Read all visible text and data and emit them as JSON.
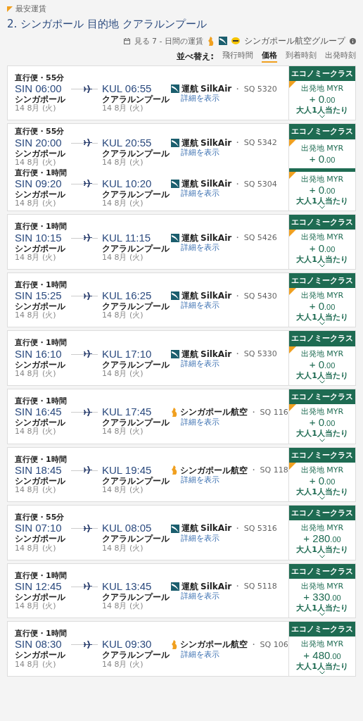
{
  "header": {
    "badge": "最安運賃",
    "title": "2. シンガポール 目的地 クアラルンプール",
    "week_link": "見る 7 - 日間の運賃",
    "group_label": "シンガポール航空グループ"
  },
  "sort": {
    "label": "並べ替え:",
    "options": [
      {
        "label": "飛行時間",
        "selected": false
      },
      {
        "label": "価格",
        "selected": true
      },
      {
        "label": "到着時刻",
        "selected": false
      },
      {
        "label": "出発時刻",
        "selected": false
      }
    ]
  },
  "cards": [
    {
      "rows": [
        {
          "duration": "直行便・55分",
          "dep_time": "SIN 06:00",
          "dep_city": "シンガポール",
          "dep_date": "14 8月 (火)",
          "arr_time": "KUL 06:55",
          "arr_city": "クアラルンプール",
          "arr_date": "14 8月 (火)",
          "kind": "regional",
          "operated": "運航",
          "airline": "SilkAir",
          "flight": "・ SQ 5320",
          "details": "詳細を表示"
        }
      ],
      "fares": [
        {
          "class_label": "エコノミークラス",
          "cheapest": true,
          "origin": "出発地 MYR",
          "sign": "+",
          "amount": "0",
          "decimals": ".00",
          "per_adult": "大人1人当たり",
          "expandable": true
        }
      ]
    },
    {
      "rows": [
        {
          "duration": "直行便・55分",
          "dep_time": "SIN 20:00",
          "dep_city": "シンガポール",
          "dep_date": "14 8月 (火)",
          "arr_time": "KUL 20:55",
          "arr_city": "クアラルンプール",
          "arr_date": "14 8月 (火)",
          "kind": "regional",
          "operated": "運航",
          "airline": "SilkAir",
          "flight": "・ SQ 5342",
          "details": "詳細を表示"
        },
        {
          "duration": "直行便・1時間",
          "dep_time": "SIN 09:20",
          "dep_city": "シンガポール",
          "dep_date": "14 8月 (火)",
          "arr_time": "KUL 10:20",
          "arr_city": "クアラルンプール",
          "arr_date": "14 8月 (火)",
          "kind": "regional",
          "operated": "運航",
          "airline": "SilkAir",
          "flight": "・ SQ 5304",
          "details": "詳細を表示"
        }
      ],
      "fares": [
        {
          "class_label": "エコノミークラス",
          "cheapest": true,
          "origin": "出発地 MYR",
          "sign": "+",
          "amount": "0",
          "decimals": ".00",
          "expandable": false
        },
        {
          "cheapest": true,
          "origin": "出発地 MYR",
          "sign": "+",
          "amount": "0",
          "decimals": ".00",
          "per_adult": "大人1人当たり",
          "expandable": true
        }
      ]
    },
    {
      "rows": [
        {
          "duration": "直行便・1時間",
          "dep_time": "SIN 10:15",
          "dep_city": "シンガポール",
          "dep_date": "14 8月 (火)",
          "arr_time": "KUL 11:15",
          "arr_city": "クアラルンプール",
          "arr_date": "14 8月 (火)",
          "kind": "regional",
          "operated": "運航",
          "airline": "SilkAir",
          "flight": "・ SQ 5426",
          "details": "詳細を表示"
        }
      ],
      "fares": [
        {
          "class_label": "エコノミークラス",
          "cheapest": true,
          "origin": "出発地 MYR",
          "sign": "+",
          "amount": "0",
          "decimals": ".00",
          "per_adult": "大人1人当たり",
          "expandable": true
        }
      ]
    },
    {
      "rows": [
        {
          "duration": "直行便・1時間",
          "dep_time": "SIN 15:25",
          "dep_city": "シンガポール",
          "dep_date": "14 8月 (火)",
          "arr_time": "KUL 16:25",
          "arr_city": "クアラルンプール",
          "arr_date": "14 8月 (火)",
          "kind": "regional",
          "operated": "運航",
          "airline": "SilkAir",
          "flight": "・ SQ 5430",
          "details": "詳細を表示"
        }
      ],
      "fares": [
        {
          "class_label": "エコノミークラス",
          "cheapest": true,
          "origin": "出発地 MYR",
          "sign": "+",
          "amount": "0",
          "decimals": ".00",
          "per_adult": "大人1人当たり",
          "expandable": true
        }
      ]
    },
    {
      "rows": [
        {
          "duration": "直行便・1時間",
          "dep_time": "SIN 16:10",
          "dep_city": "シンガポール",
          "dep_date": "14 8月 (火)",
          "arr_time": "KUL 17:10",
          "arr_city": "クアラルンプール",
          "arr_date": "14 8月 (火)",
          "kind": "regional",
          "operated": "運航",
          "airline": "SilkAir",
          "flight": "・ SQ 5330",
          "details": "詳細を表示"
        }
      ],
      "fares": [
        {
          "class_label": "エコノミークラス",
          "cheapest": true,
          "origin": "出発地 MYR",
          "sign": "+",
          "amount": "0",
          "decimals": ".00",
          "per_adult": "大人1人当たり",
          "expandable": true
        }
      ]
    },
    {
      "rows": [
        {
          "duration": "直行便・1時間",
          "dep_time": "SIN 16:45",
          "dep_city": "シンガポール",
          "dep_date": "14 8月 (火)",
          "arr_time": "KUL 17:45",
          "arr_city": "クアラルンプール",
          "arr_date": "14 8月 (火)",
          "kind": "mainline",
          "airline": "シンガポール航空",
          "flight": "・ SQ 116",
          "details": "詳細を表示"
        }
      ],
      "fares": [
        {
          "class_label": "エコノミークラス",
          "cheapest": true,
          "origin": "出発地 MYR",
          "sign": "+",
          "amount": "0",
          "decimals": ".00",
          "per_adult": "大人1人当たり",
          "expandable": true
        }
      ]
    },
    {
      "rows": [
        {
          "duration": "直行便・1時間",
          "dep_time": "SIN 18:45",
          "dep_city": "シンガポール",
          "dep_date": "14 8月 (火)",
          "arr_time": "KUL 19:45",
          "arr_city": "クアラルンプール",
          "arr_date": "14 8月 (火)",
          "kind": "mainline",
          "airline": "シンガポール航空",
          "flight": "・ SQ 118",
          "details": "詳細を表示"
        }
      ],
      "fares": [
        {
          "class_label": "エコノミークラス",
          "cheapest": true,
          "origin": "出発地 MYR",
          "sign": "+",
          "amount": "0",
          "decimals": ".00",
          "per_adult": "大人1人当たり",
          "expandable": true
        }
      ]
    },
    {
      "rows": [
        {
          "duration": "直行便・55分",
          "dep_time": "SIN 07:10",
          "dep_city": "シンガポール",
          "dep_date": "14 8月 (火)",
          "arr_time": "KUL 08:05",
          "arr_city": "クアラルンプール",
          "arr_date": "14 8月 (火)",
          "kind": "regional",
          "operated": "運航",
          "airline": "SilkAir",
          "flight": "・ SQ 5316",
          "details": "詳細を表示"
        }
      ],
      "fares": [
        {
          "class_label": "エコノミークラス",
          "cheapest": false,
          "origin": "出発地 MYR",
          "sign": "+",
          "amount": "280",
          "decimals": ".00",
          "per_adult": "大人1人当たり",
          "expandable": true
        }
      ]
    },
    {
      "rows": [
        {
          "duration": "直行便・1時間",
          "dep_time": "SIN 12:45",
          "dep_city": "シンガポール",
          "dep_date": "14 8月 (火)",
          "arr_time": "KUL 13:45",
          "arr_city": "クアラルンプール",
          "arr_date": "14 8月 (火)",
          "kind": "regional",
          "operated": "運航",
          "airline": "SilkAir",
          "flight": "・ SQ 5118",
          "details": "詳細を表示"
        }
      ],
      "fares": [
        {
          "class_label": "エコノミークラス",
          "cheapest": false,
          "origin": "出発地 MYR",
          "sign": "+",
          "amount": "330",
          "decimals": ".00",
          "per_adult": "大人1人当たり",
          "expandable": true
        }
      ]
    },
    {
      "rows": [
        {
          "duration": "直行便・1時間",
          "dep_time": "SIN 08:30",
          "dep_city": "シンガポール",
          "dep_date": "14 8月 (火)",
          "arr_time": "KUL 09:30",
          "arr_city": "クアラルンプール",
          "arr_date": "14 8月 (火)",
          "kind": "mainline",
          "airline": "シンガポール航空",
          "flight": "・ SQ 106",
          "details": "詳細を表示"
        }
      ],
      "fares": [
        {
          "class_label": "エコノミークラス",
          "cheapest": false,
          "origin": "出発地 MYR",
          "sign": "+",
          "amount": "480",
          "decimals": ".00",
          "per_adult": "大人1人当たり",
          "expandable": true
        }
      ]
    }
  ]
}
